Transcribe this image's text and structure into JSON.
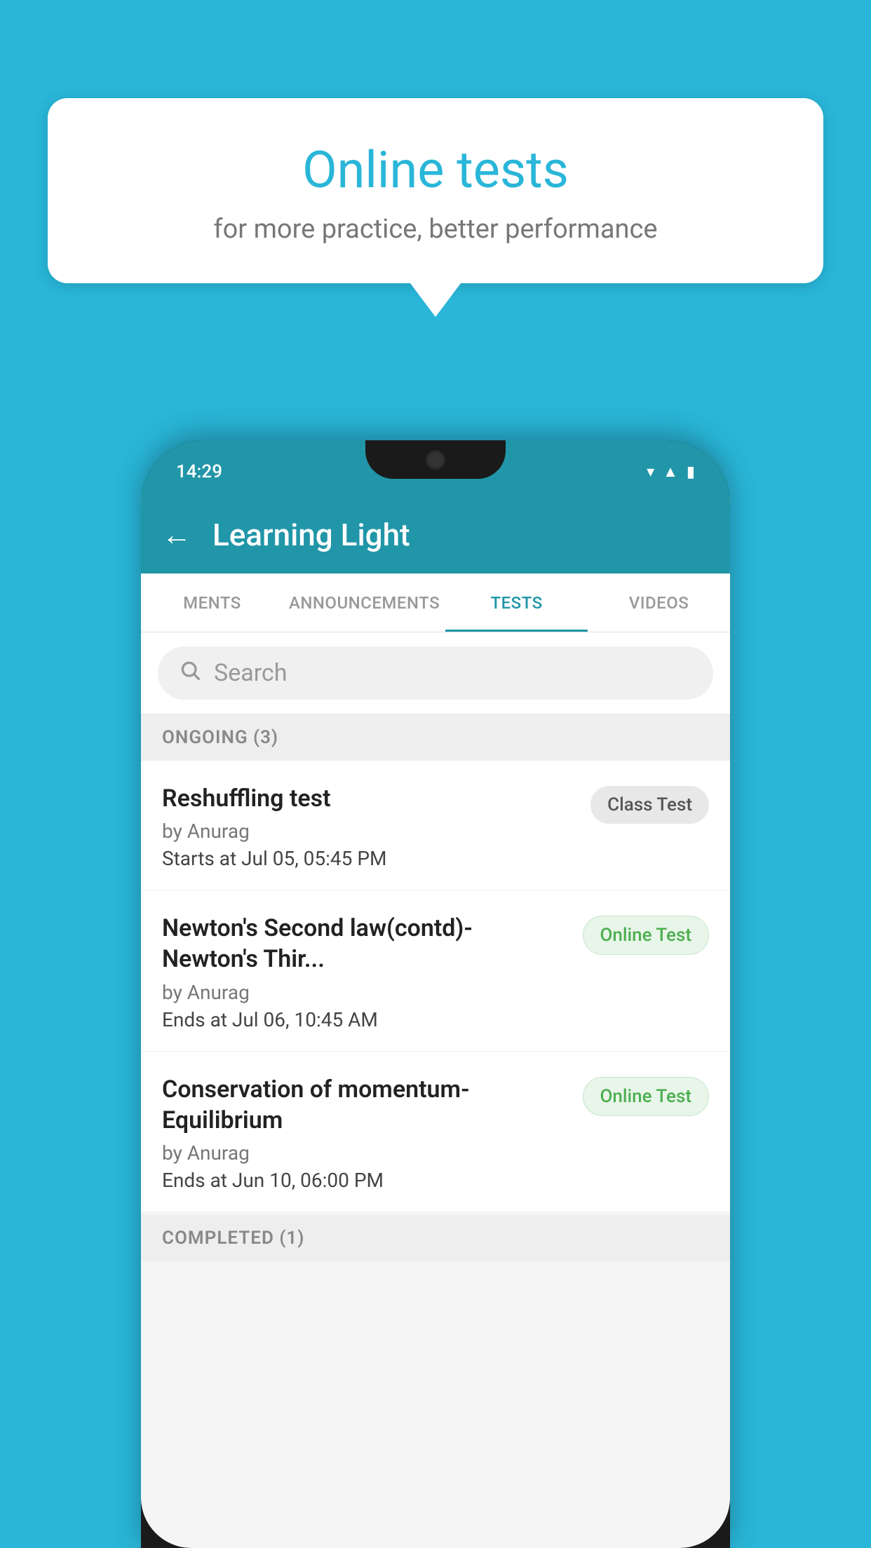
{
  "background": {
    "color": "#29b6d8"
  },
  "speech_bubble": {
    "title": "Online tests",
    "subtitle": "for more practice, better performance"
  },
  "phone": {
    "status_bar": {
      "time": "14:29",
      "icons": [
        "wifi",
        "signal",
        "battery"
      ]
    },
    "app_header": {
      "title": "Learning Light",
      "back_label": "←"
    },
    "tabs": [
      {
        "label": "MENTS",
        "active": false
      },
      {
        "label": "ANNOUNCEMENTS",
        "active": false
      },
      {
        "label": "TESTS",
        "active": true
      },
      {
        "label": "VIDEOS",
        "active": false
      }
    ],
    "search": {
      "placeholder": "Search"
    },
    "ongoing_section": {
      "title": "ONGOING (3)",
      "tests": [
        {
          "name": "Reshuffling test",
          "author": "by Anurag",
          "date_label": "Starts at",
          "date": "Jul 05, 05:45 PM",
          "badge": "Class Test",
          "badge_type": "class"
        },
        {
          "name": "Newton's Second law(contd)-Newton's Thir...",
          "author": "by Anurag",
          "date_label": "Ends at",
          "date": "Jul 06, 10:45 AM",
          "badge": "Online Test",
          "badge_type": "online"
        },
        {
          "name": "Conservation of momentum-Equilibrium",
          "author": "by Anurag",
          "date_label": "Ends at",
          "date": "Jun 10, 06:00 PM",
          "badge": "Online Test",
          "badge_type": "online"
        }
      ]
    },
    "completed_section": {
      "title": "COMPLETED (1)"
    }
  }
}
